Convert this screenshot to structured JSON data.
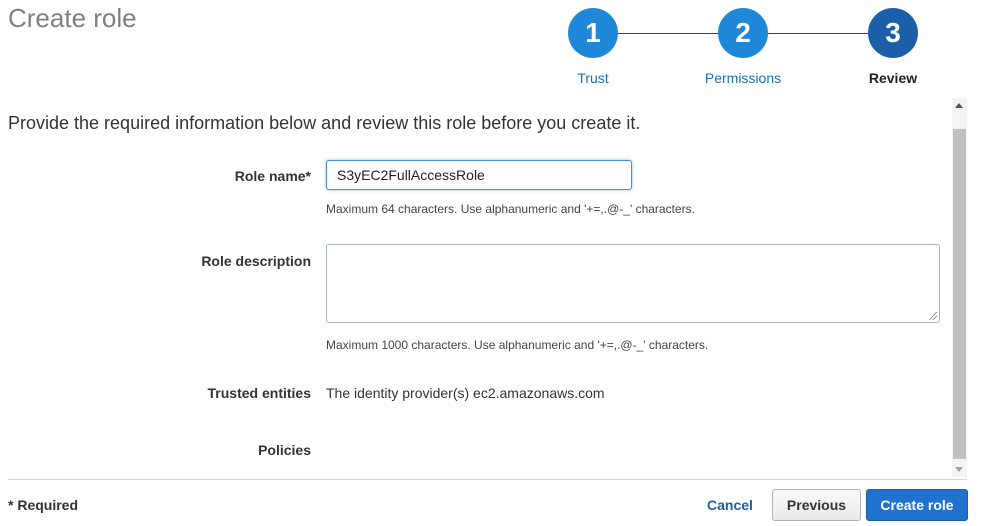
{
  "page": {
    "title": "Create role",
    "intro": "Provide the required information below and review this role before you create it."
  },
  "wizard": {
    "steps": [
      {
        "number": "1",
        "label": "Trust",
        "state": "done"
      },
      {
        "number": "2",
        "label": "Permissions",
        "state": "done"
      },
      {
        "number": "3",
        "label": "Review",
        "state": "current"
      }
    ]
  },
  "form": {
    "role_name": {
      "label": "Role name*",
      "value": "S3yEC2FullAccessRole",
      "hint": "Maximum 64 characters. Use alphanumeric and '+=,.@-_' characters."
    },
    "role_description": {
      "label": "Role description",
      "value": "",
      "hint": "Maximum 1000 characters. Use alphanumeric and '+=,.@-_' characters."
    },
    "trusted_entities": {
      "label": "Trusted entities",
      "value": "The identity provider(s) ec2.amazonaws.com"
    },
    "policies": {
      "label": "Policies"
    }
  },
  "footer": {
    "required_note": "* Required",
    "cancel_label": "Cancel",
    "previous_label": "Previous",
    "create_label": "Create role"
  },
  "colors": {
    "step_done": "#1f87d8",
    "step_current": "#1a5fa8",
    "primary_button": "#1f73cf",
    "link": "#1a6fb4"
  }
}
